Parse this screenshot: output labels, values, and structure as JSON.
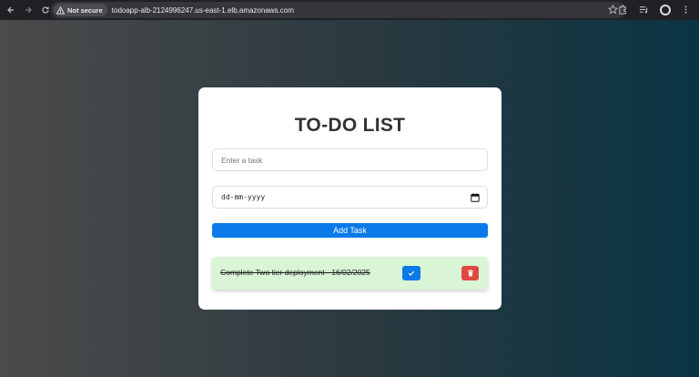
{
  "browser": {
    "security_label": "Not secure",
    "url": "todoapp-alb-2124996247.us-east-1.elb.amazonaws.com"
  },
  "app": {
    "title": "TO-DO LIST",
    "task_input": {
      "placeholder": "Enter a task",
      "value": ""
    },
    "date_input": {
      "display": "dd-mm-yyyy"
    },
    "add_button_label": "Add Task",
    "tasks": [
      {
        "text": "Complete Two tier deployment - 16/02/2025",
        "completed": true
      }
    ]
  },
  "colors": {
    "primary": "#0a7ae8",
    "danger": "#e0493f",
    "completed_bg": "#d9f5d6"
  }
}
